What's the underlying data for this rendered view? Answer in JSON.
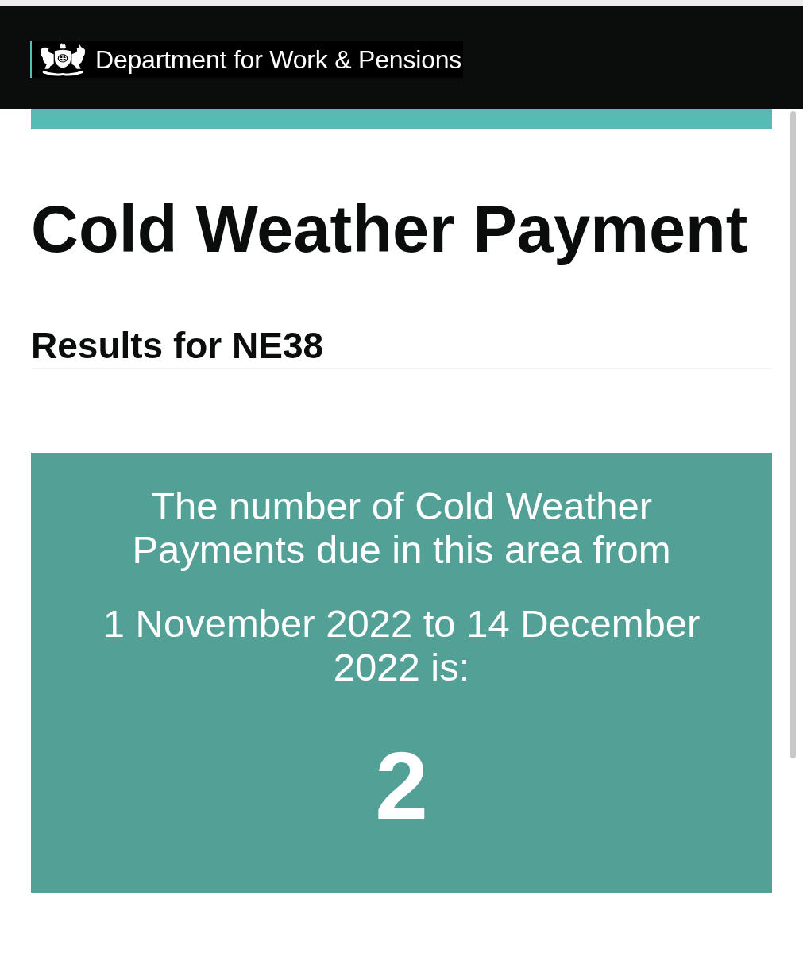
{
  "header": {
    "organisation": "Department for Work & Pensions"
  },
  "page": {
    "title": "Cold Weather Payment",
    "subtitle": "Results for NE38"
  },
  "result_panel": {
    "intro": "The number of Cold Weather Payments due in this area from",
    "period": "1 November 2022 to 14 December 2022 is:",
    "count": "2"
  }
}
